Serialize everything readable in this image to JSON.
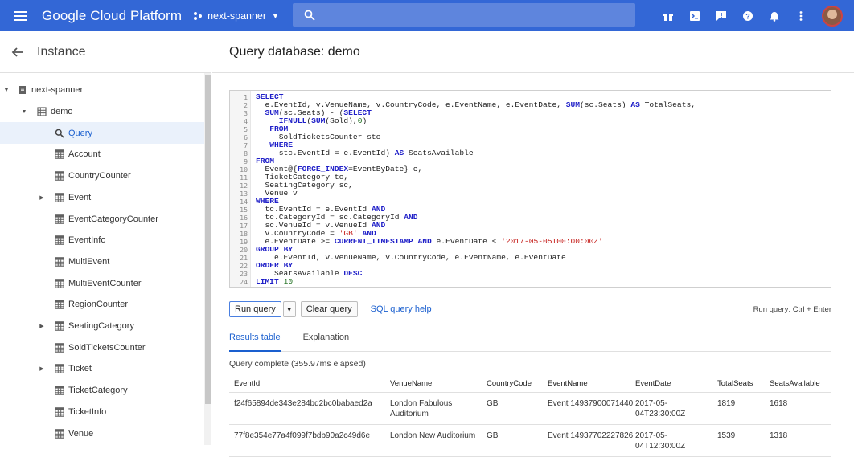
{
  "topbar": {
    "brand": "Google Cloud Platform",
    "project": "next-spanner",
    "search_placeholder": ""
  },
  "sidebar": {
    "title": "Instance",
    "tree": [
      {
        "label": "next-spanner",
        "level": 0,
        "expand": "open",
        "icon": "instance-icon"
      },
      {
        "label": "demo",
        "level": 1,
        "expand": "open",
        "icon": "database-icon"
      },
      {
        "label": "Query",
        "level": 2,
        "expand": "none",
        "icon": "search-icon",
        "selected": true
      },
      {
        "label": "Account",
        "level": 2,
        "expand": "none",
        "icon": "table-icon"
      },
      {
        "label": "CountryCounter",
        "level": 2,
        "expand": "none",
        "icon": "table-icon"
      },
      {
        "label": "Event",
        "level": 2,
        "expand": "closed",
        "icon": "table-icon"
      },
      {
        "label": "EventCategoryCounter",
        "level": 2,
        "expand": "none",
        "icon": "table-icon"
      },
      {
        "label": "EventInfo",
        "level": 2,
        "expand": "none",
        "icon": "table-icon"
      },
      {
        "label": "MultiEvent",
        "level": 2,
        "expand": "none",
        "icon": "table-icon"
      },
      {
        "label": "MultiEventCounter",
        "level": 2,
        "expand": "none",
        "icon": "table-icon"
      },
      {
        "label": "RegionCounter",
        "level": 2,
        "expand": "none",
        "icon": "table-icon"
      },
      {
        "label": "SeatingCategory",
        "level": 2,
        "expand": "closed",
        "icon": "table-icon"
      },
      {
        "label": "SoldTicketsCounter",
        "level": 2,
        "expand": "none",
        "icon": "table-icon"
      },
      {
        "label": "Ticket",
        "level": 2,
        "expand": "closed",
        "icon": "table-icon"
      },
      {
        "label": "TicketCategory",
        "level": 2,
        "expand": "none",
        "icon": "table-icon"
      },
      {
        "label": "TicketInfo",
        "level": 2,
        "expand": "none",
        "icon": "table-icon"
      },
      {
        "label": "Venue",
        "level": 2,
        "expand": "none",
        "icon": "table-icon"
      }
    ]
  },
  "main": {
    "title": "Query database: demo",
    "code_lines": [
      "SELECT",
      "  e.EventId, v.VenueName, v.CountryCode, e.EventName, e.EventDate, SUM(sc.Seats) AS TotalSeats,",
      "  SUM(sc.Seats) - (SELECT",
      "     IFNULL(SUM(Sold),0)",
      "   FROM",
      "     SoldTicketsCounter stc",
      "   WHERE",
      "     stc.EventId = e.EventId) AS SeatsAvailable",
      "FROM",
      "  Event@{FORCE_INDEX=EventByDate} e,",
      "  TicketCategory tc,",
      "  SeatingCategory sc,",
      "  Venue v",
      "WHERE",
      "  tc.EventId = e.EventId AND",
      "  tc.CategoryId = sc.CategoryId AND",
      "  sc.VenueId = v.VenueId AND",
      "  v.CountryCode = 'GB' AND",
      "  e.EventDate >= CURRENT_TIMESTAMP AND e.EventDate < '2017-05-05T00:00:00Z'",
      "GROUP BY",
      "    e.EventId, v.VenueName, v.CountryCode, e.EventName, e.EventDate",
      "ORDER BY",
      "    SeatsAvailable DESC",
      "LIMIT 10"
    ],
    "run_button": "Run query",
    "clear_button": "Clear query",
    "help_link": "SQL query help",
    "shortcut_label": "Run query:",
    "shortcut_keys": "Ctrl + Enter",
    "tabs": [
      "Results table",
      "Explanation"
    ],
    "status": "Query complete (355.97ms elapsed)",
    "columns": [
      "EventId",
      "VenueName",
      "CountryCode",
      "EventName",
      "EventDate",
      "TotalSeats",
      "SeatsAvailable"
    ],
    "rows": [
      [
        "f24f65894de343e284bd2bc0babaed2a",
        "London Fabulous Auditorium",
        "GB",
        "Event 14937900071440",
        "2017-05-04T23:30:00Z",
        "1819",
        "1618"
      ],
      [
        "77f8e354e77a4f099f7bdb90a2c49d6e",
        "London New Auditorium",
        "GB",
        "Event 14937702227826",
        "2017-05-04T12:30:00Z",
        "1539",
        "1318"
      ]
    ]
  }
}
